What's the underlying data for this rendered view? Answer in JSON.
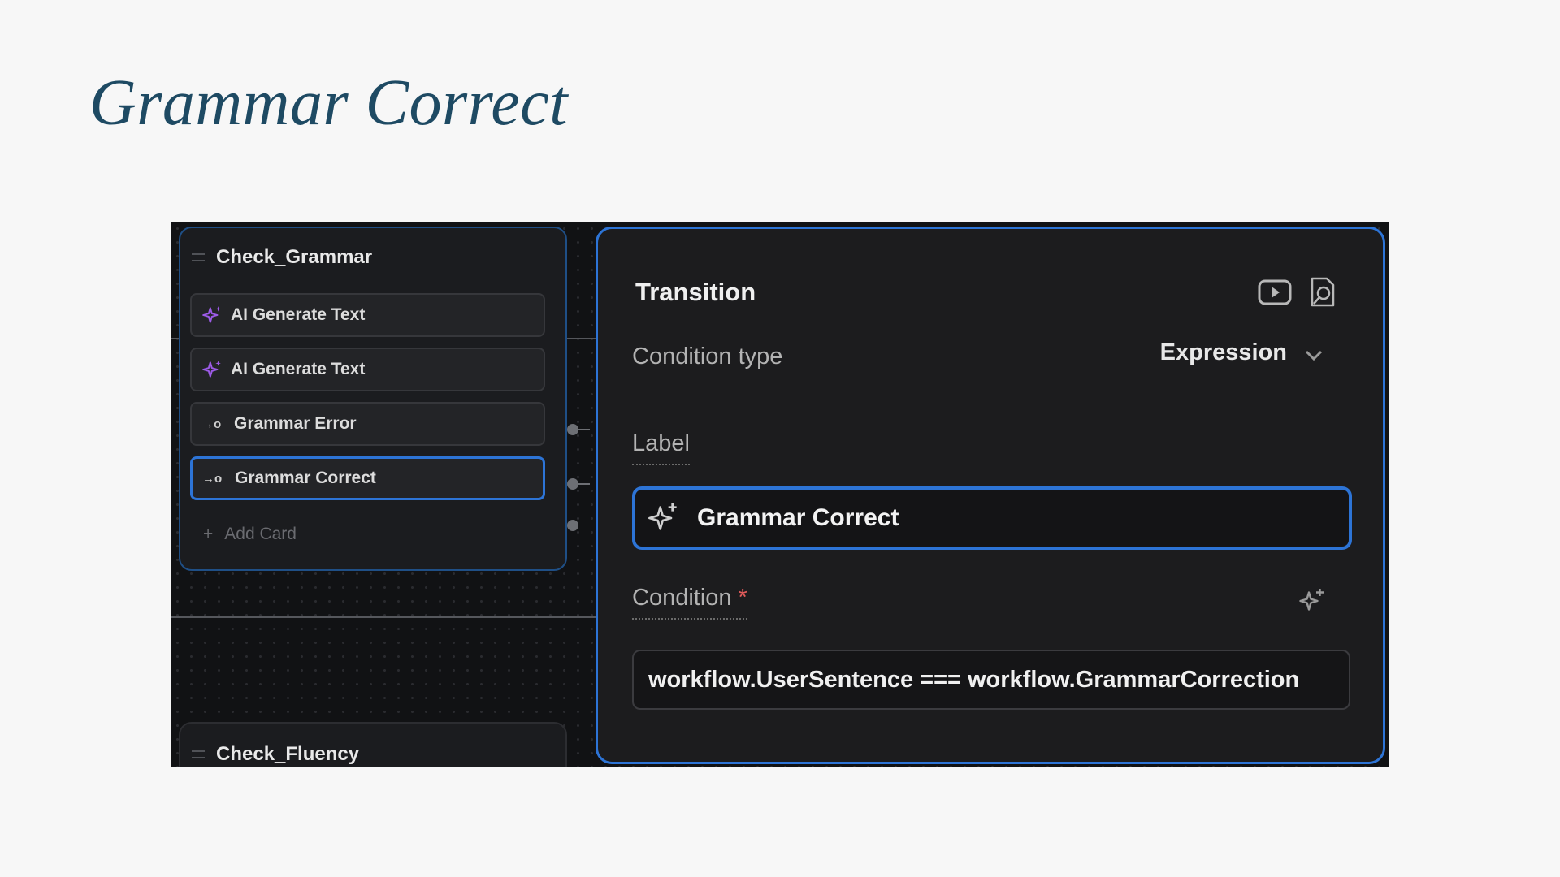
{
  "slide": {
    "title": "Grammar Correct"
  },
  "canvas": {
    "node_main": {
      "title": "Check_Grammar",
      "cards": [
        {
          "label": "AI Generate Text",
          "icon": "sparkle-icon",
          "selected": false
        },
        {
          "label": "AI Generate Text",
          "icon": "sparkle-icon",
          "selected": false
        },
        {
          "label": "Grammar Error",
          "icon": "transition-icon",
          "selected": false
        },
        {
          "label": "Grammar Correct",
          "icon": "transition-icon",
          "selected": true
        }
      ],
      "add_card_label": "Add Card"
    },
    "node_second": {
      "title": "Check_Fluency"
    }
  },
  "panel": {
    "title": "Transition",
    "condition_type_label": "Condition type",
    "condition_type_value": "Expression",
    "label_field_label": "Label",
    "label_value": "Grammar Correct",
    "condition_label": "Condition",
    "required_mark": "*",
    "condition_value": "workflow.UserSentence === workflow.GrammarCorrection"
  },
  "colors": {
    "title": "#1e4a63",
    "accent_blue": "#2d74d6",
    "ai_purple": "#9d5be8",
    "required_red": "#e25b5b"
  }
}
